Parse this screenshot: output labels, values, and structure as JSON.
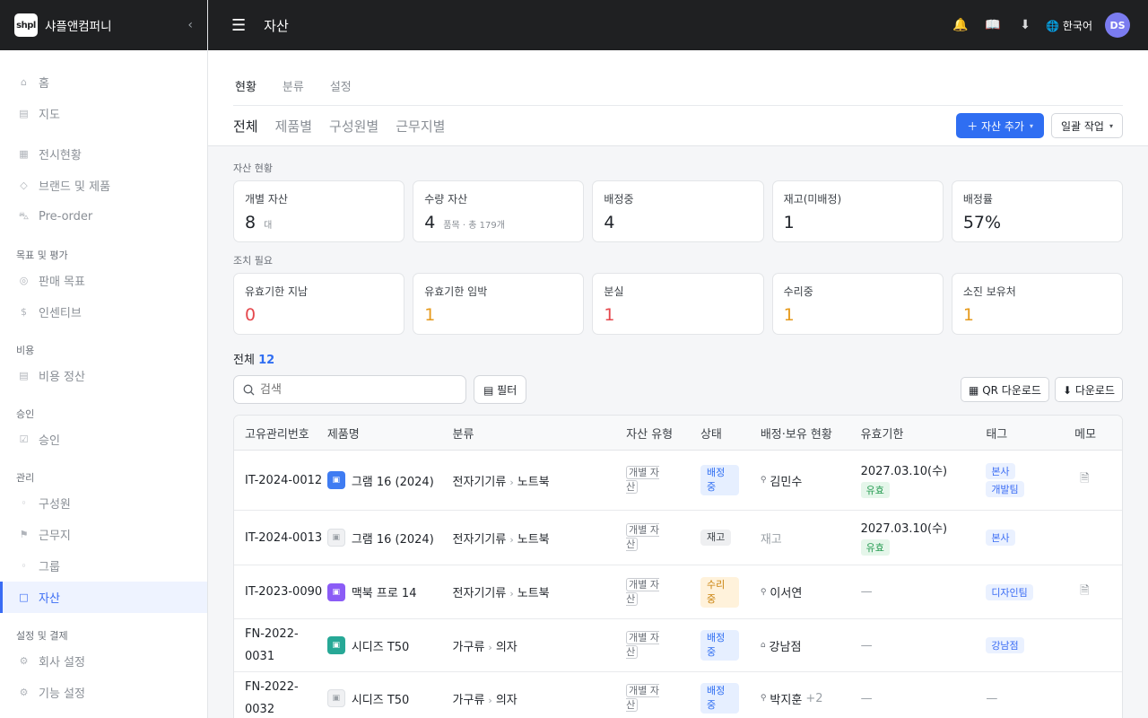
{
  "sidebar": {
    "logo": "shpl",
    "company": "샤플앤컴퍼니",
    "collapse": "‹",
    "items": [
      {
        "label": "홈",
        "icon": "⌂"
      },
      {
        "label": "지도",
        "icon": "▤"
      },
      {
        "label": "전시현황",
        "icon": "▦"
      },
      {
        "label": "브랜드 및 제품",
        "icon": "◇"
      },
      {
        "label": "Pre-order",
        "icon": "⛍"
      },
      {
        "label": "판매 목표",
        "icon": "◎"
      },
      {
        "label": "인센티브",
        "icon": "$"
      },
      {
        "label": "비용 정산",
        "icon": "▤"
      },
      {
        "label": "승인",
        "icon": "☑"
      },
      {
        "label": "구성원",
        "icon": "◦"
      },
      {
        "label": "근무지",
        "icon": "⚑"
      },
      {
        "label": "그룹",
        "icon": "◦"
      },
      {
        "label": "자산",
        "icon": "□"
      },
      {
        "label": "회사 설정",
        "icon": "⚙"
      },
      {
        "label": "기능 설정",
        "icon": "⚙"
      }
    ],
    "sections": [
      "목표 및 평가",
      "비용",
      "승인",
      "관리",
      "설정 및 결제"
    ]
  },
  "topbar": {
    "menu": "☰",
    "title": "자산",
    "bell": "🔔",
    "book": "📖",
    "download": "⬇",
    "lang": "🌐 한국어",
    "avatar": "DS"
  },
  "page_tabs": [
    "현황",
    "분류",
    "설정"
  ],
  "sub_tabs": [
    "전체",
    "제품별",
    "구성원별",
    "근무지별"
  ],
  "actions": {
    "add": "＋ 자산 추가",
    "bulk": "일괄 작업",
    "caret": "▾"
  },
  "status_section": {
    "label": "자산 현황",
    "cards": [
      {
        "label": "개별 자산",
        "value": "8",
        "sub": "대"
      },
      {
        "label": "수량 자산",
        "value": "4",
        "sub": "품목 · 총 179개"
      },
      {
        "label": "배정중",
        "value": "4",
        "sub": ""
      },
      {
        "label": "재고(미배정)",
        "value": "1",
        "sub": ""
      },
      {
        "label": "배정률",
        "value": "57%",
        "sub": ""
      }
    ]
  },
  "action_section": {
    "label": "조치 필요",
    "cards": [
      {
        "label": "유효기한 지남",
        "value": "0"
      },
      {
        "label": "유효기한 임박",
        "value": "1"
      },
      {
        "label": "분실",
        "value": "1"
      },
      {
        "label": "수리중",
        "value": "1"
      },
      {
        "label": "소진 보유처",
        "value": "1"
      }
    ]
  },
  "list": {
    "total_label": "전체",
    "total_count": "12",
    "search_placeholder": "검색",
    "filter": "▤ 필터",
    "qr": "▦ QR 다운로드",
    "download": "⬇ 다운로드"
  },
  "table": {
    "headers": [
      "고유관리번호",
      "제품명",
      "분류",
      "자산 유형",
      "상태",
      "배정·보유 현황",
      "유효기한",
      "태그",
      "메모"
    ],
    "rows": [
      {
        "id": "IT-2024-0012",
        "product": "그램 16 (2024)",
        "cat1": "전자기기류",
        "cat2": "노트북",
        "type": "개별 자산",
        "status": "배정중",
        "assign": "김민수",
        "date": "2027.03.10(수)",
        "valid": "유효",
        "tags": [
          "본사",
          "개발팀"
        ],
        "memo": "🗎"
      },
      {
        "id": "IT-2024-0013",
        "product": "그램 16 (2024)",
        "cat1": "전자기기류",
        "cat2": "노트북",
        "type": "개별 자산",
        "status": "재고",
        "assign": "재고",
        "date": "2027.03.10(수)",
        "valid": "유효",
        "tags": [
          "본사"
        ],
        "memo": ""
      },
      {
        "id": "IT-2023-0090",
        "product": "맥북 프로 14",
        "cat1": "전자기기류",
        "cat2": "노트북",
        "type": "개별 자산",
        "status": "수리중",
        "assign": "이서연",
        "date": "—",
        "tags": [
          "디자인팀"
        ],
        "memo": "🗎"
      },
      {
        "id": "FN-2022-0031",
        "product": "시디즈 T50",
        "cat1": "가구류",
        "cat2": "의자",
        "type": "개별 자산",
        "status": "배정중",
        "assign": "강남점",
        "date": "—",
        "tags": [
          "강남점"
        ],
        "memo": ""
      },
      {
        "id": "FN-2022-0032",
        "product": "시디즈 T50",
        "cat1": "가구류",
        "cat2": "의자",
        "type": "개별 자산",
        "status": "배정중",
        "assign": "박지훈",
        "extra": "+2",
        "date": "—",
        "tag_none": "—",
        "memo": ""
      }
    ]
  },
  "colors": {
    "accent": "#2f6ef2",
    "topbar": "#1f2022",
    "danger": "#e5484d",
    "warning": "#e69a1c"
  }
}
